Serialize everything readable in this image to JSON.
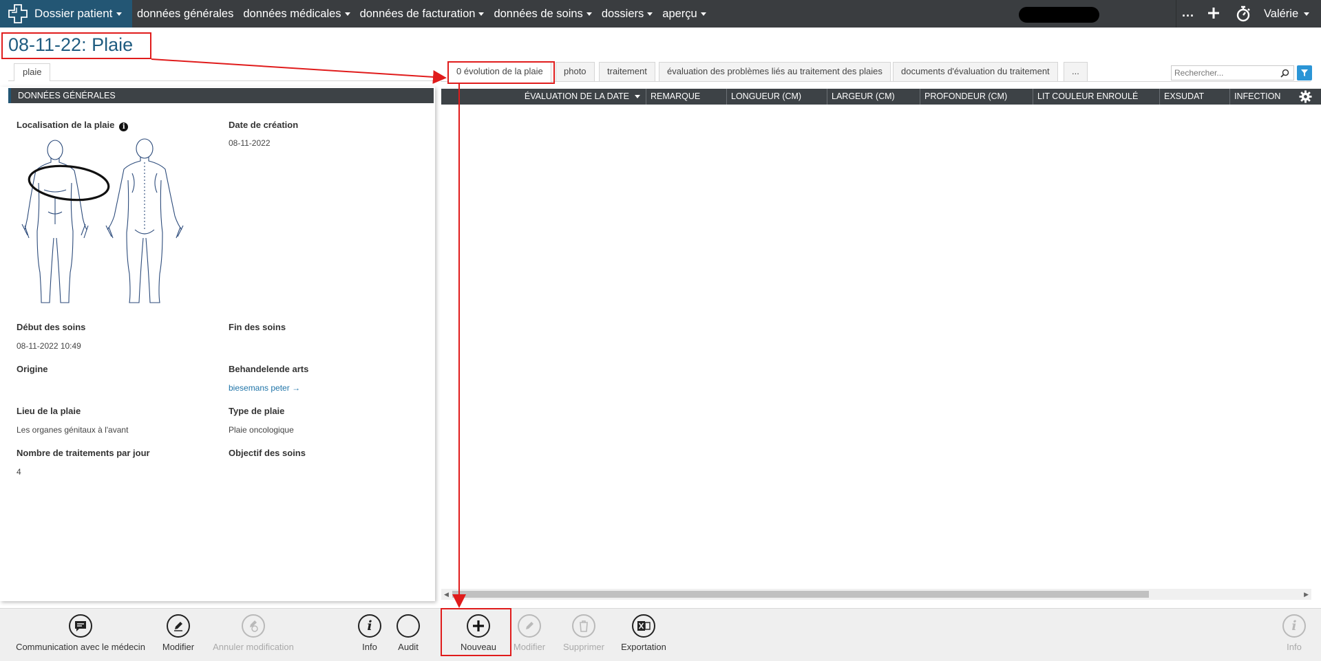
{
  "nav": {
    "brand": "Dossier patient",
    "items": [
      {
        "label": "données générales",
        "dropdown": false
      },
      {
        "label": "données médicales",
        "dropdown": true
      },
      {
        "label": "données de facturation",
        "dropdown": true
      },
      {
        "label": "données de soins",
        "dropdown": true
      },
      {
        "label": "dossiers",
        "dropdown": true
      },
      {
        "label": "aperçu",
        "dropdown": true
      }
    ],
    "more": "...",
    "user": "Valérie"
  },
  "page": {
    "title": "08-11-22: Plaie"
  },
  "left": {
    "tab": "plaie",
    "section_title": "DONNÉES GÉNÉRALES",
    "fields": {
      "localisation_label": "Localisation de la plaie",
      "date_creation_label": "Date de création",
      "date_creation_value": "08-11-2022",
      "debut_label": "Début des soins",
      "debut_value": "08-11-2022 10:49",
      "fin_label": "Fin des soins",
      "origine_label": "Origine",
      "arts_label": "Behandelende arts",
      "arts_value": "biesemans peter",
      "lieu_label": "Lieu de la plaie",
      "lieu_value": "Les organes génitaux à l'avant",
      "type_label": "Type de plaie",
      "type_value": "Plaie oncologique",
      "nombre_label": "Nombre de traitements par jour",
      "nombre_value": "4",
      "objectif_label": "Objectif des soins"
    }
  },
  "right": {
    "tabs": [
      "0 évolution de la plaie",
      "photo",
      "traitement",
      "évaluation des problèmes liés au traitement des plaies",
      "documents d'évaluation du traitement",
      "..."
    ],
    "active_tab": 0,
    "search_placeholder": "Rechercher...",
    "columns": [
      "ÉVALUATION DE LA DATE",
      "REMARQUE",
      "LONGUEUR (CM)",
      "LARGEUR (CM)",
      "PROFONDEUR (CM)",
      "LIT COULEUR ENROULÉ",
      "EXSUDAT",
      "INFECTION"
    ]
  },
  "toolbar": {
    "buttons": [
      {
        "label": "Communication avec le médecin",
        "icon": "chat-icon",
        "enabled": true
      },
      {
        "label": "Modifier",
        "icon": "pencil-icon",
        "enabled": true
      },
      {
        "label": "Annuler modification",
        "icon": "undo-edit-icon",
        "enabled": false
      },
      {
        "label": "Info",
        "icon": "info-icon",
        "enabled": true
      },
      {
        "label": "Audit",
        "icon": "audit-icon",
        "enabled": true
      },
      {
        "label": "Nouveau",
        "icon": "plus-icon",
        "enabled": true
      },
      {
        "label": "Modifier",
        "icon": "pencil-icon",
        "enabled": false
      },
      {
        "label": "Supprimer",
        "icon": "trash-icon",
        "enabled": false
      },
      {
        "label": "Exportation",
        "icon": "excel-icon",
        "enabled": true
      },
      {
        "label": "Info",
        "icon": "info-icon",
        "enabled": false
      }
    ]
  },
  "colors": {
    "nav_bg": "#3a3d40",
    "brand_bg": "#235674",
    "title": "#1f5c80",
    "highlight": "#e01b1b",
    "grid_header": "#3d4246",
    "filter_btn": "#2b95d6"
  }
}
